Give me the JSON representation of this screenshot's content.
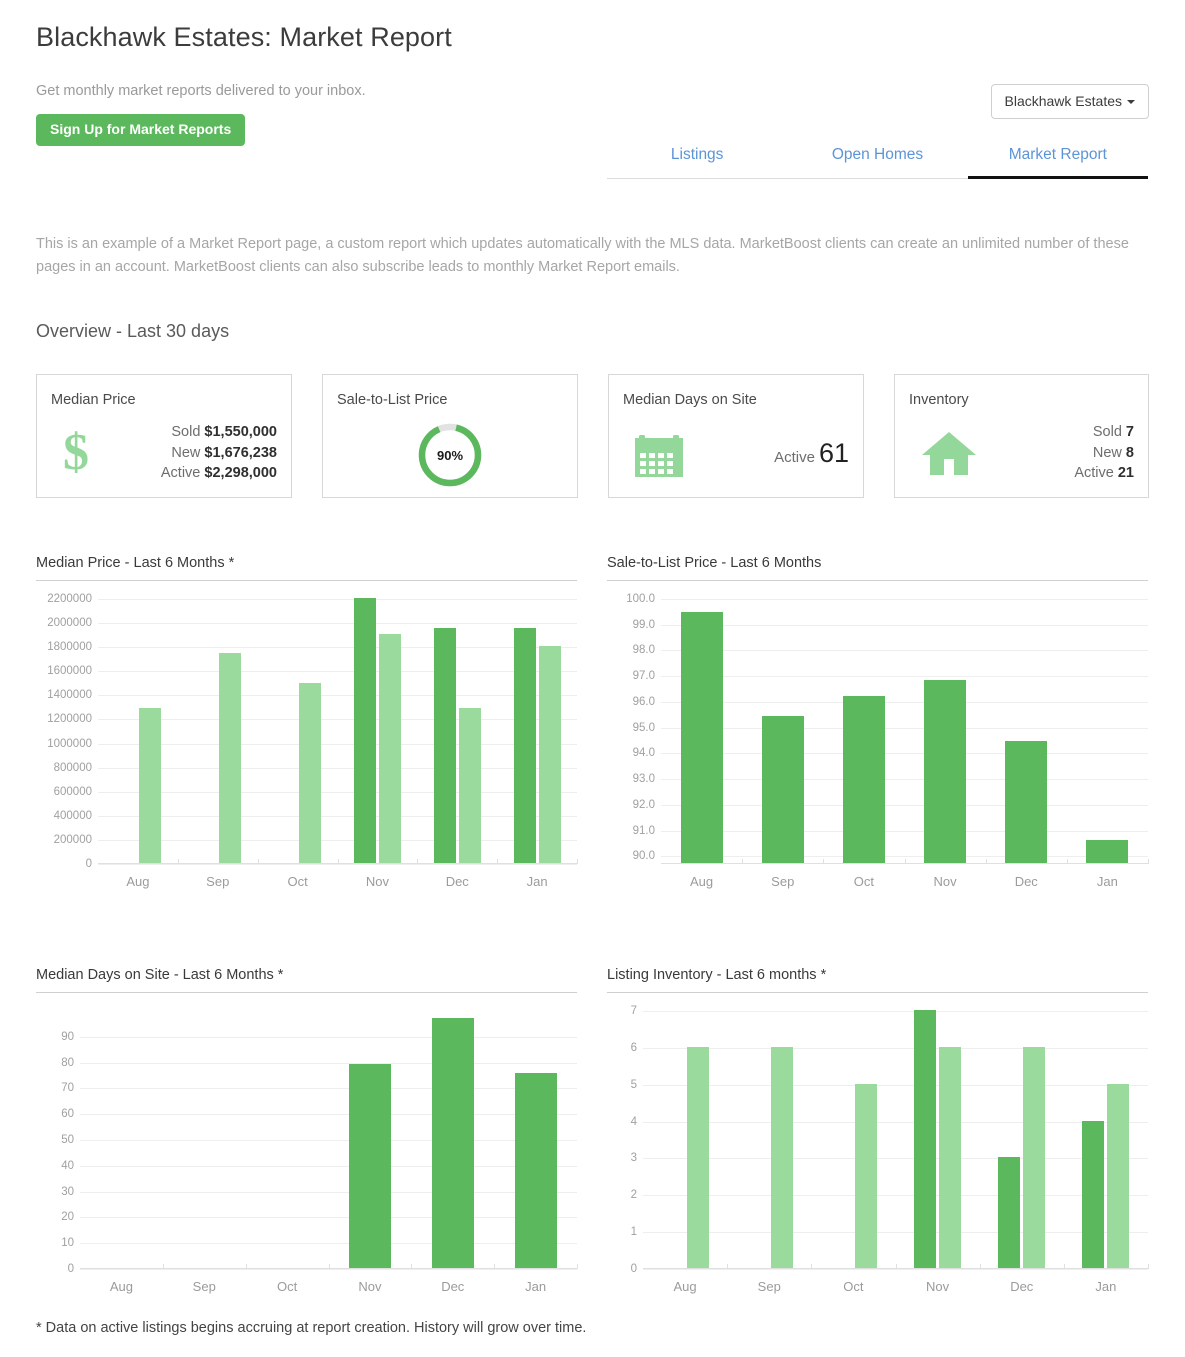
{
  "header": {
    "title": "Blackhawk Estates: Market Report",
    "subtitle": "Get monthly market reports delivered to your inbox.",
    "signup_button": "Sign Up for Market Reports",
    "dropdown_label": "Blackhawk Estates"
  },
  "tabs": [
    {
      "label": "Listings",
      "active": false
    },
    {
      "label": "Open Homes",
      "active": false
    },
    {
      "label": "Market Report",
      "active": true
    }
  ],
  "description": "This is an example of a Market Report page, a custom report which updates automatically with the MLS data. MarketBoost clients can create an unlimited number of these pages in an account. MarketBoost clients can also subscribe leads to monthly Market Report emails.",
  "overview": {
    "heading": "Overview - Last 30 days",
    "cards": [
      {
        "title": "Median Price",
        "icon": "dollar-icon",
        "rows": [
          {
            "label": "Sold",
            "value": "$1,550,000"
          },
          {
            "label": "New",
            "value": "$1,676,238"
          },
          {
            "label": "Active",
            "value": "$2,298,000"
          }
        ]
      },
      {
        "title": "Sale-to-List Price",
        "icon": "donut-gauge",
        "gauge_percent": 90,
        "gauge_text": "90%"
      },
      {
        "title": "Median Days on Site",
        "icon": "calendar-icon",
        "rows": [
          {
            "label": "Active",
            "value": "61"
          }
        ]
      },
      {
        "title": "Inventory",
        "icon": "house-icon",
        "rows": [
          {
            "label": "Sold",
            "value": "7"
          },
          {
            "label": "New",
            "value": "8"
          },
          {
            "label": "Active",
            "value": "21"
          }
        ]
      }
    ]
  },
  "footnote": "* Data on active listings begins accruing at report creation. History will grow over time.",
  "colors": {
    "sold_bar": "#5cb85c",
    "active_bar": "#9adb9d",
    "accent_green": "#5cb85c",
    "icon_green": "#94d79a",
    "tab_link": "#5c94d6",
    "tab_active_underline": "#111111"
  },
  "chart_data": [
    {
      "id": "median-price",
      "type": "bar",
      "title": "Median Price - Last 6 Months *",
      "categories": [
        "Aug",
        "Sep",
        "Oct",
        "Nov",
        "Dec",
        "Jan"
      ],
      "series": [
        {
          "name": "Sold",
          "color": "#5cb85c",
          "values": [
            null,
            null,
            null,
            2200000,
            1950000,
            1950000
          ]
        },
        {
          "name": "Active",
          "color": "#9adb9d",
          "values": [
            1285000,
            1740000,
            1497000,
            1900000,
            1285000,
            1805000
          ]
        }
      ],
      "xlabel": "",
      "ylabel": "",
      "ylim": [
        0,
        2200000
      ],
      "yticks": [
        0,
        200000,
        400000,
        600000,
        800000,
        1000000,
        1200000,
        1400000,
        1600000,
        1800000,
        2000000,
        2200000
      ],
      "ytick_labels": [
        "0",
        "200000",
        "400000",
        "600000",
        "800000",
        "1000000",
        "1200000",
        "1400000",
        "1600000",
        "1800000",
        "2000000",
        "2200000"
      ],
      "grid": true,
      "legend": "none"
    },
    {
      "id": "sale-to-list",
      "type": "bar",
      "title": "Sale-to-List Price - Last 6 Months",
      "categories": [
        "Aug",
        "Sep",
        "Oct",
        "Nov",
        "Dec",
        "Jan"
      ],
      "series": [
        {
          "name": "Sale-to-List %",
          "color": "#5cb85c",
          "values": [
            99.45,
            95.4,
            96.2,
            96.8,
            94.45,
            90.6
          ]
        }
      ],
      "xlabel": "",
      "ylabel": "",
      "ylim": [
        89.7,
        100.0
      ],
      "yticks": [
        90.0,
        91.0,
        92.0,
        93.0,
        94.0,
        95.0,
        96.0,
        97.0,
        98.0,
        99.0,
        100.0
      ],
      "ytick_labels": [
        "90.0",
        "91.0",
        "92.0",
        "93.0",
        "94.0",
        "95.0",
        "96.0",
        "97.0",
        "98.0",
        "99.0",
        "100.0"
      ],
      "grid": true,
      "legend": "none"
    },
    {
      "id": "median-days-on-site",
      "type": "bar",
      "title": "Median Days on Site - Last 6 Months *",
      "categories": [
        "Aug",
        "Sep",
        "Oct",
        "Nov",
        "Dec",
        "Jan"
      ],
      "series": [
        {
          "name": "Days on Site",
          "color": "#5cb85c",
          "values": [
            null,
            null,
            null,
            79,
            97,
            75.5
          ]
        }
      ],
      "xlabel": "",
      "ylabel": "",
      "ylim": [
        0,
        100
      ],
      "yticks": [
        0,
        10,
        20,
        30,
        40,
        50,
        60,
        70,
        80,
        90
      ],
      "ytick_labels": [
        "0",
        "10",
        "20",
        "30",
        "40",
        "50",
        "60",
        "70",
        "80",
        "90"
      ],
      "grid": true,
      "legend": "none"
    },
    {
      "id": "listing-inventory",
      "type": "bar",
      "title": "Listing Inventory - Last 6 months *",
      "categories": [
        "Aug",
        "Sep",
        "Oct",
        "Nov",
        "Dec",
        "Jan"
      ],
      "series": [
        {
          "name": "Sold",
          "color": "#5cb85c",
          "values": [
            null,
            null,
            null,
            7,
            3,
            4
          ]
        },
        {
          "name": "Active",
          "color": "#9adb9d",
          "values": [
            6,
            6,
            5,
            6,
            6,
            5
          ]
        }
      ],
      "xlabel": "",
      "ylabel": "",
      "ylim": [
        0,
        7
      ],
      "yticks": [
        0,
        1,
        2,
        3,
        4,
        5,
        6,
        7
      ],
      "ytick_labels": [
        "0",
        "1",
        "2",
        "3",
        "4",
        "5",
        "6",
        "7"
      ],
      "grid": true,
      "legend": "none"
    }
  ]
}
